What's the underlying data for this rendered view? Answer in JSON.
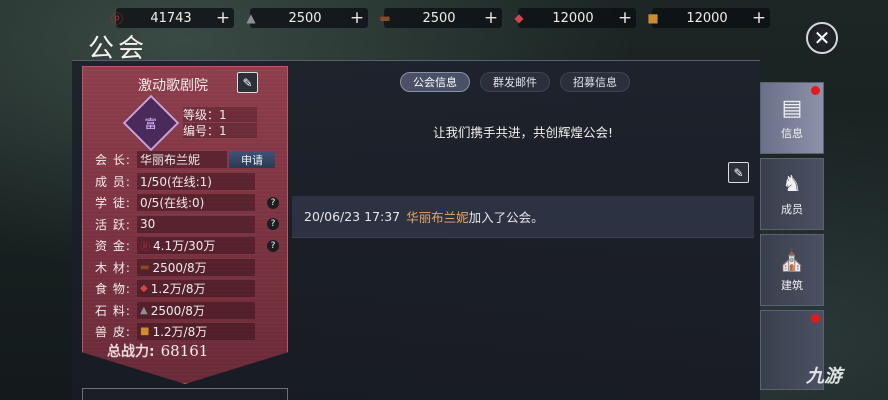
{
  "resources": [
    {
      "icon": "coin-icon",
      "glyph": "ⓟ",
      "color": "#c22a36",
      "value": "41743"
    },
    {
      "icon": "ore-icon",
      "glyph": "▲",
      "color": "#8c8f96",
      "value": "2500"
    },
    {
      "icon": "wood-icon",
      "glyph": "▬",
      "color": "#8a4a28",
      "value": "2500"
    },
    {
      "icon": "meat-icon",
      "glyph": "◆",
      "color": "#d0454a",
      "value": "12000"
    },
    {
      "icon": "hide-icon",
      "glyph": "■",
      "color": "#d08a30",
      "value": "12000"
    }
  ],
  "plus_label": "+",
  "close_glyph": "✕",
  "title": "公会",
  "guild": {
    "name": "激动歌剧院",
    "edit_glyph": "✎",
    "emblem_char": "富",
    "level": "等级：1",
    "number": "编号：1",
    "rows": [
      {
        "label": "会  长:",
        "value": "华丽布兰妮",
        "action": "申请"
      },
      {
        "label": "成  员:",
        "value": "1/50(在线:1)"
      },
      {
        "label": "学  徒:",
        "value": "0/5(在线:0)",
        "help": "?"
      },
      {
        "label": "活  跃:",
        "value": "30",
        "help": "?"
      },
      {
        "label": "资  金:",
        "icon": "coin-icon",
        "glyph": "ⓟ",
        "color": "#c22a36",
        "value": "4.1万/30万",
        "help": "?"
      },
      {
        "label": "木  材:",
        "icon": "wood-icon",
        "glyph": "▬",
        "color": "#8a4a28",
        "value": "2500/8万"
      },
      {
        "label": "食  物:",
        "icon": "meat-icon",
        "glyph": "◆",
        "color": "#d0454a",
        "value": "1.2万/8万"
      },
      {
        "label": "石  料:",
        "icon": "ore-icon",
        "glyph": "▲",
        "color": "#8c8f96",
        "value": "2500/8万"
      },
      {
        "label": "兽  皮:",
        "icon": "hide-icon",
        "glyph": "■",
        "color": "#d08a30",
        "value": "1.2万/8万"
      }
    ],
    "power_label": "总战力:",
    "power_value": "68161"
  },
  "tabs": [
    {
      "label": "公会信息",
      "active": true
    },
    {
      "label": "群发邮件",
      "active": false
    },
    {
      "label": "招募信息",
      "active": false
    }
  ],
  "slogan": "让我们携手共进，共创辉煌公会!",
  "log": {
    "time": "20/06/23 17:37",
    "who": "华丽布兰妮",
    "text": "加入了公会。"
  },
  "side_tabs": [
    {
      "name": "info",
      "label": "信息",
      "glyph": "▤",
      "active": true,
      "dot": true
    },
    {
      "name": "members",
      "label": "成员",
      "glyph": "♞",
      "active": false,
      "dot": false
    },
    {
      "name": "buildings",
      "label": "建筑",
      "glyph": "⛪",
      "active": false,
      "dot": false
    }
  ],
  "watermark": "九游"
}
